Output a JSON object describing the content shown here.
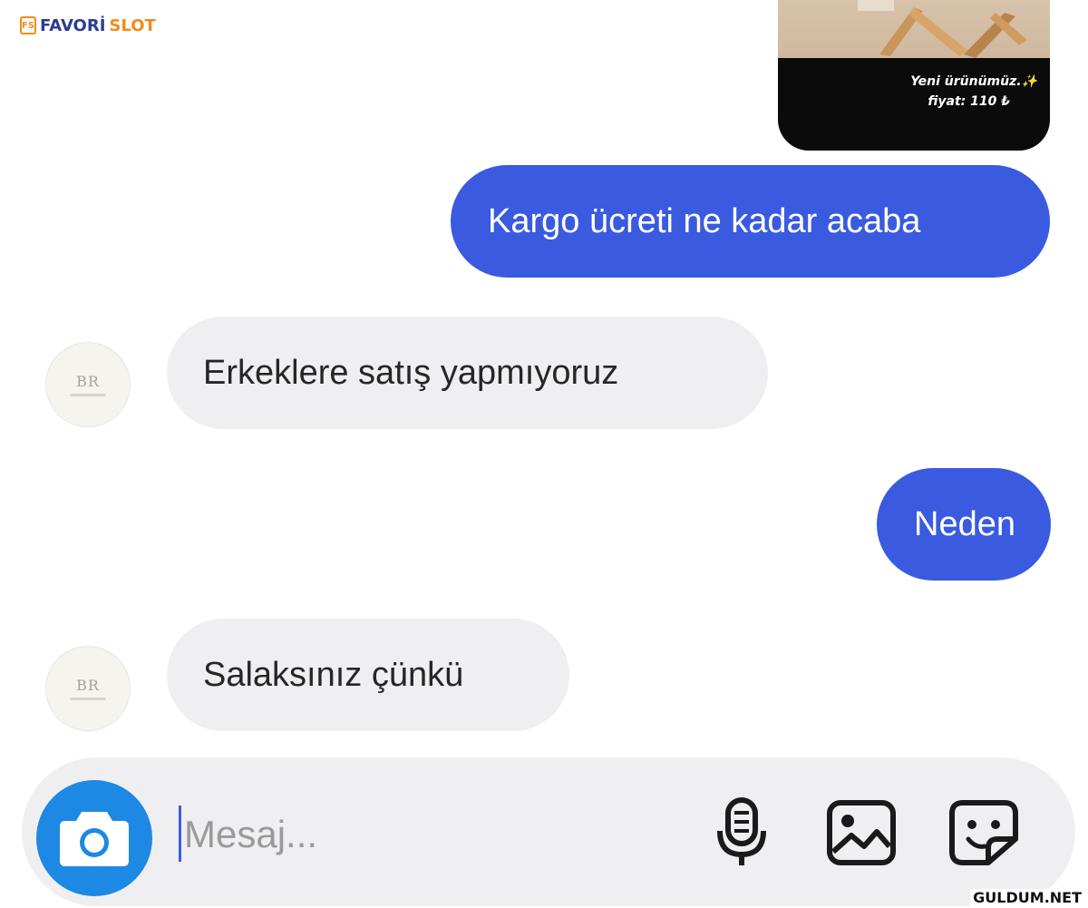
{
  "watermark": {
    "logo_prefix": "FAVORİ",
    "logo_suffix": "SLOT",
    "logo_mark": "FS",
    "site": "GULDUM.NET"
  },
  "product_card": {
    "caption_line1": "Yeni ürünümüz.✨",
    "caption_line2": "fiyat: 110 ₺"
  },
  "messages": [
    {
      "direction": "outgoing",
      "text": "Kargo ücreti ne kadar acaba"
    },
    {
      "direction": "incoming",
      "text": "Erkeklere satış yapmıyoruz",
      "avatar": "BR"
    },
    {
      "direction": "outgoing",
      "text": "Neden"
    },
    {
      "direction": "incoming",
      "text": "Salaksınız çünkü",
      "avatar": "BR"
    }
  ],
  "composer": {
    "placeholder": "Mesaj...",
    "icons": [
      "camera-icon",
      "microphone-icon",
      "gallery-icon",
      "sticker-icon"
    ]
  },
  "colors": {
    "outgoing_bubble": "#3a5be0",
    "incoming_bubble": "#efeff1",
    "camera_button": "#1e88e5"
  }
}
